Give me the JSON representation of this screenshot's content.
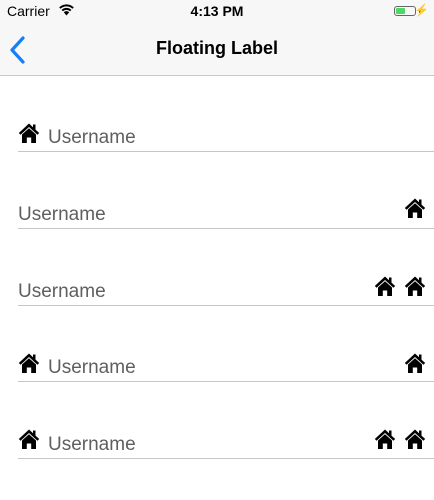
{
  "status": {
    "carrier": "Carrier",
    "time": "4:13 PM",
    "charging": "⚡"
  },
  "nav": {
    "title": "Floating Label"
  },
  "icons": {
    "home": "home-icon",
    "back": "chevron-left-icon",
    "wifi": "wifi-icon"
  },
  "colors": {
    "accent": "#147efb",
    "label": "#5f5f5f",
    "divider": "#c6c6c6",
    "battery": "#4cd964"
  },
  "fields": [
    {
      "label": "Username",
      "left_icons": 1,
      "right_icons": 0
    },
    {
      "label": "Username",
      "left_icons": 0,
      "right_icons": 1
    },
    {
      "label": "Username",
      "left_icons": 0,
      "right_icons": 2
    },
    {
      "label": "Username",
      "left_icons": 1,
      "right_icons": 1
    },
    {
      "label": "Username",
      "left_icons": 1,
      "right_icons": 2
    }
  ]
}
